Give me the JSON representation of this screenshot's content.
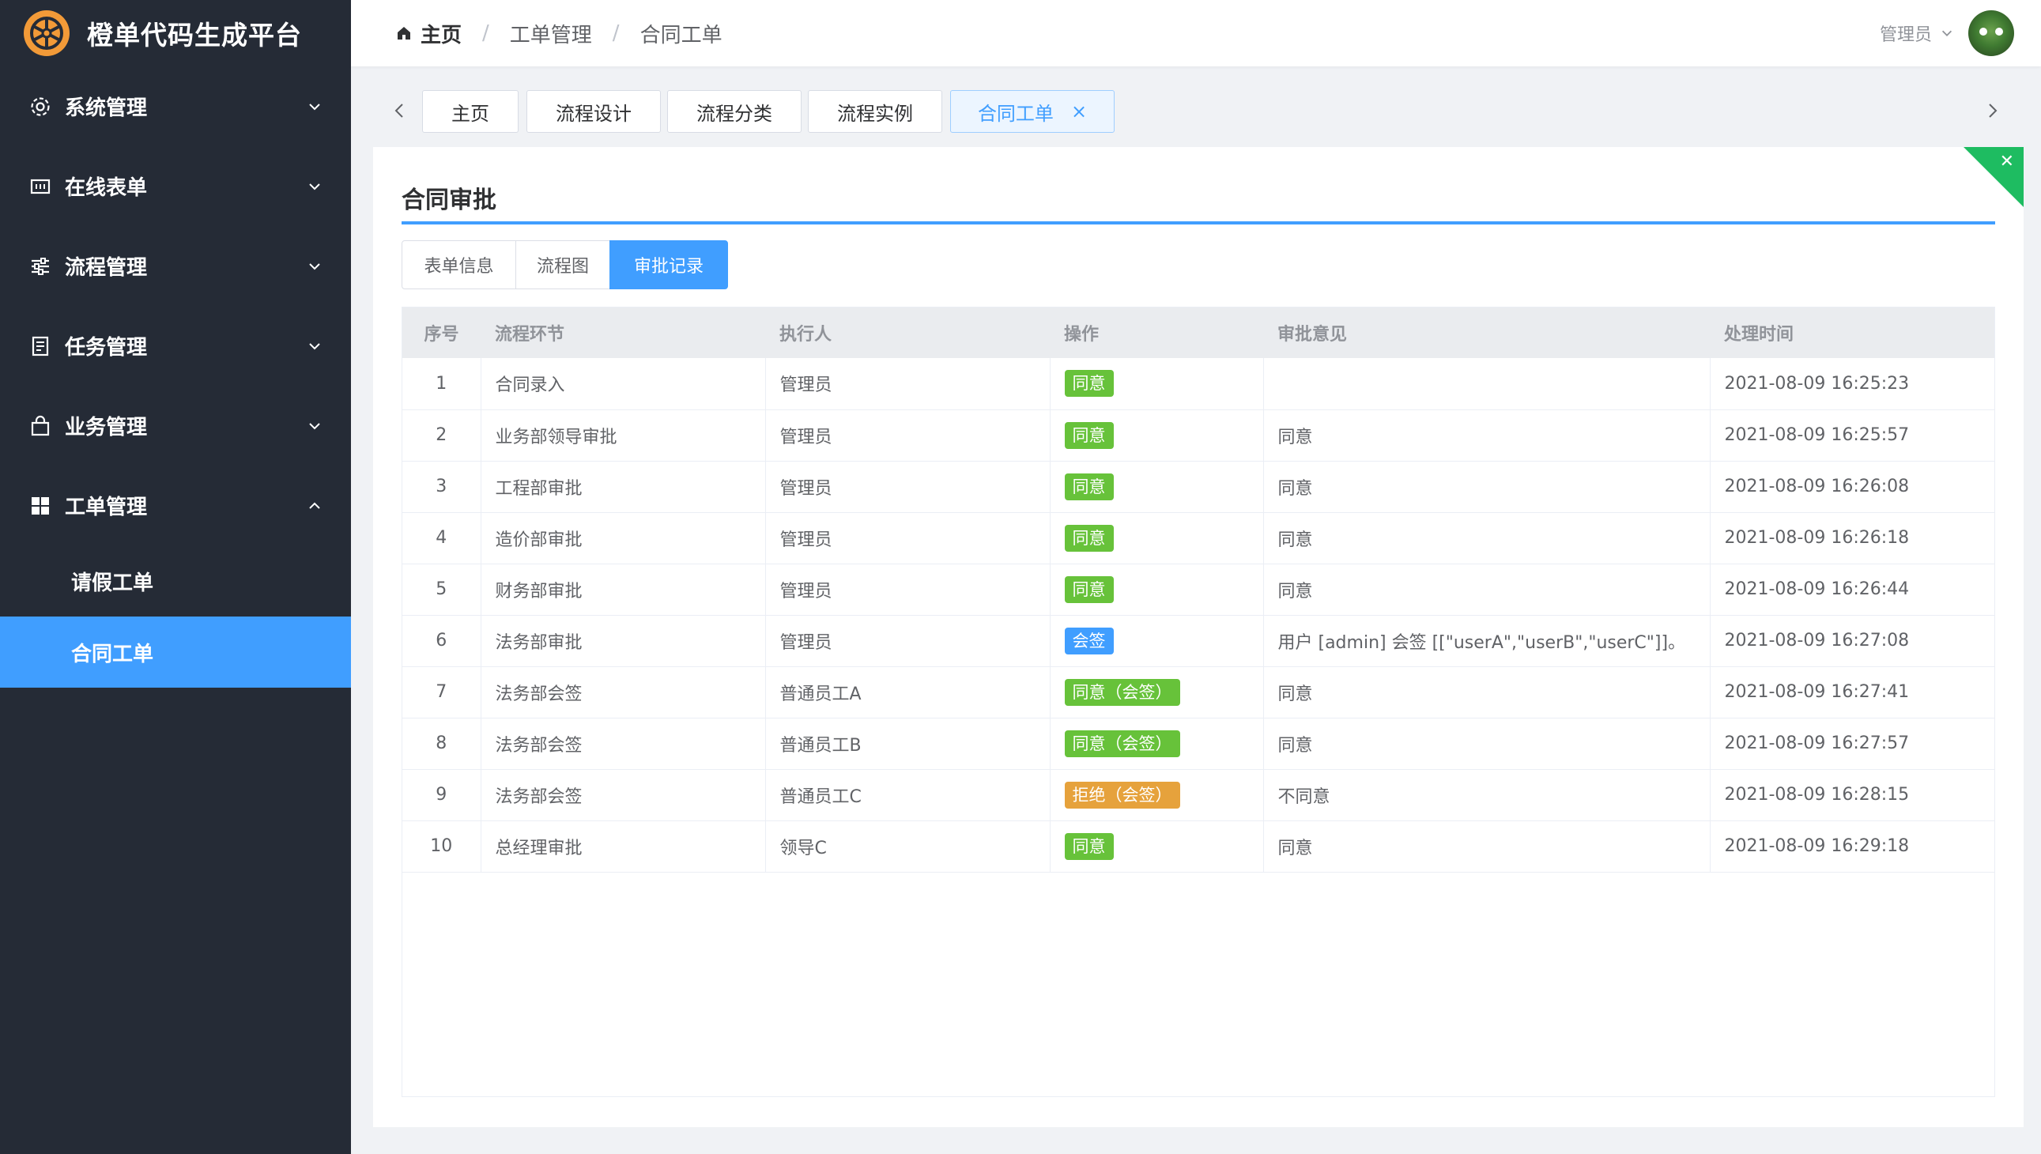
{
  "app": {
    "title": "橙单代码生成平台"
  },
  "sidebar": {
    "items": [
      {
        "label": "系统管理",
        "icon": "gear-icon"
      },
      {
        "label": "在线表单",
        "icon": "form-icon"
      },
      {
        "label": "流程管理",
        "icon": "sliders-icon"
      },
      {
        "label": "任务管理",
        "icon": "document-icon"
      },
      {
        "label": "业务管理",
        "icon": "bag-icon"
      },
      {
        "label": "工单管理",
        "icon": "grid-icon",
        "expanded": true
      }
    ],
    "sub_items": [
      {
        "label": "请假工单"
      },
      {
        "label": "合同工单",
        "active": true
      }
    ]
  },
  "header": {
    "breadcrumb": [
      "主页",
      "工单管理",
      "合同工单"
    ],
    "user": "管理员"
  },
  "tabs": [
    "主页",
    "流程设计",
    "流程分类",
    "流程实例",
    "合同工单"
  ],
  "card": {
    "title": "合同审批",
    "subtabs": [
      "表单信息",
      "流程图",
      "审批记录"
    ]
  },
  "table": {
    "headers": [
      "序号",
      "流程环节",
      "执行人",
      "操作",
      "审批意见",
      "处理时间"
    ],
    "rows": [
      {
        "idx": "1",
        "step": "合同录入",
        "user": "管理员",
        "action": "同意",
        "tag": "green",
        "comment": "",
        "time": "2021-08-09 16:25:23"
      },
      {
        "idx": "2",
        "step": "业务部领导审批",
        "user": "管理员",
        "action": "同意",
        "tag": "green",
        "comment": "同意",
        "time": "2021-08-09 16:25:57"
      },
      {
        "idx": "3",
        "step": "工程部审批",
        "user": "管理员",
        "action": "同意",
        "tag": "green",
        "comment": "同意",
        "time": "2021-08-09 16:26:08"
      },
      {
        "idx": "4",
        "step": "造价部审批",
        "user": "管理员",
        "action": "同意",
        "tag": "green",
        "comment": "同意",
        "time": "2021-08-09 16:26:18"
      },
      {
        "idx": "5",
        "step": "财务部审批",
        "user": "管理员",
        "action": "同意",
        "tag": "green",
        "comment": "同意",
        "time": "2021-08-09 16:26:44"
      },
      {
        "idx": "6",
        "step": "法务部审批",
        "user": "管理员",
        "action": "会签",
        "tag": "blue",
        "comment": "用户 [admin] 会签 [[\"userA\",\"userB\",\"userC\"]]。",
        "time": "2021-08-09 16:27:08"
      },
      {
        "idx": "7",
        "step": "法务部会签",
        "user": "普通员工A",
        "action": "同意（会签）",
        "tag": "green",
        "comment": "同意",
        "time": "2021-08-09 16:27:41"
      },
      {
        "idx": "8",
        "step": "法务部会签",
        "user": "普通员工B",
        "action": "同意（会签）",
        "tag": "green",
        "comment": "同意",
        "time": "2021-08-09 16:27:57"
      },
      {
        "idx": "9",
        "step": "法务部会签",
        "user": "普通员工C",
        "action": "拒绝（会签）",
        "tag": "orange",
        "comment": "不同意",
        "time": "2021-08-09 16:28:15"
      },
      {
        "idx": "10",
        "step": "总经理审批",
        "user": "领导C",
        "action": "同意",
        "tag": "green",
        "comment": "同意",
        "time": "2021-08-09 16:29:18"
      }
    ]
  },
  "colors": {
    "sidebar_bg": "#252b36",
    "primary": "#409eff",
    "success": "#67c23a",
    "warning": "#e6a23c",
    "brand_orange": "#f29a38",
    "close_corner": "#1ebc61"
  }
}
